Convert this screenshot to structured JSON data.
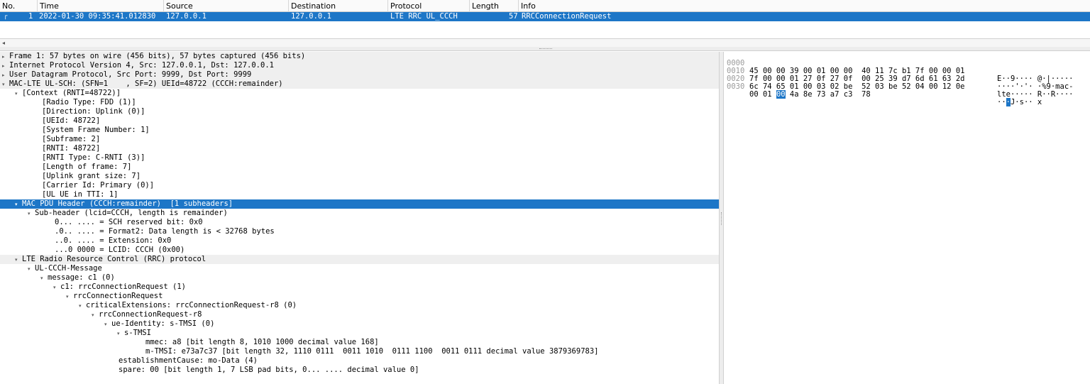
{
  "packet_list": {
    "columns": [
      "No.",
      "Time",
      "Source",
      "Destination",
      "Protocol",
      "Length",
      "Info"
    ],
    "rows": [
      {
        "no": "1",
        "time": "2022-01-30 09:35:41.012830",
        "source": "127.0.0.1",
        "destination": "127.0.0.1",
        "protocol": "LTE RRC UL_CCCH",
        "length": "57",
        "info": "RRCConnectionRequest"
      }
    ]
  },
  "details": {
    "rows": [
      "Frame 1: 57 bytes on wire (456 bits), 57 bytes captured (456 bits)",
      "Internet Protocol Version 4, Src: 127.0.0.1, Dst: 127.0.0.1",
      "User Datagram Protocol, Src Port: 9999, Dst Port: 9999",
      "MAC-LTE UL-SCH: (SFN=1    , SF=2) UEId=48722 (CCCH:remainder)",
      "[Context (RNTI=48722)]",
      "[Radio Type: FDD (1)]",
      "[Direction: Uplink (0)]",
      "[UEId: 48722]",
      "[System Frame Number: 1]",
      "[Subframe: 2]",
      "[RNTI: 48722]",
      "[RNTI Type: C-RNTI (3)]",
      "[Length of frame: 7]",
      "[Uplink grant size: 7]",
      "[Carrier Id: Primary (0)]",
      "[UL UE in TTI: 1]",
      "MAC PDU Header (CCCH:remainder)  [1 subheaders]",
      "Sub-header (lcid=CCCH, length is remainder)",
      "0... .... = SCH reserved bit: 0x0",
      ".0.. .... = Format2: Data length is < 32768 bytes",
      "..0. .... = Extension: 0x0",
      "...0 0000 = LCID: CCCH (0x00)",
      "LTE Radio Resource Control (RRC) protocol",
      "UL-CCCH-Message",
      "message: c1 (0)",
      "c1: rrcConnectionRequest (1)",
      "rrcConnectionRequest",
      "criticalExtensions: rrcConnectionRequest-r8 (0)",
      "rrcConnectionRequest-r8",
      "ue-Identity: s-TMSI (0)",
      "s-TMSI",
      "mmec: a8 [bit length 8, 1010 1000 decimal value 168]",
      "m-TMSI: e73a7c37 [bit length 32, 1110 0111  0011 1010  0111 1100  0011 0111 decimal value 3879369783]",
      "establishmentCause: mo-Data (4)",
      "spare: 00 [bit length 1, 7 LSB pad bits, 0... .... decimal value 0]"
    ]
  },
  "bytes": {
    "rows": [
      {
        "offset": "0000",
        "hex1": "45 00 00 39 00 01 00 00",
        "hex2": "40 11 7c b1 7f 00 00 01",
        "ascii": "E··9···· @·|·····"
      },
      {
        "offset": "0010",
        "hex1": "7f 00 00 01 27 0f 27 0f",
        "hex2": "00 25 39 d7 6d 61 63 2d",
        "ascii": "····'·'· ·%9·mac-"
      },
      {
        "offset": "0020",
        "hex1": "6c 74 65 01 00 03 02 be",
        "hex2": "52 03 be 52 04 00 12 0e",
        "ascii": "lte····· R··R····"
      },
      {
        "offset": "0030",
        "hex_pre": "00 01 ",
        "hex_hl": "00",
        "hex_post": " 4a 8e 73 a7 c3  78",
        "ascii_pre": "··",
        "ascii_hl": "·",
        "ascii_post": "J·s·· x"
      }
    ]
  }
}
